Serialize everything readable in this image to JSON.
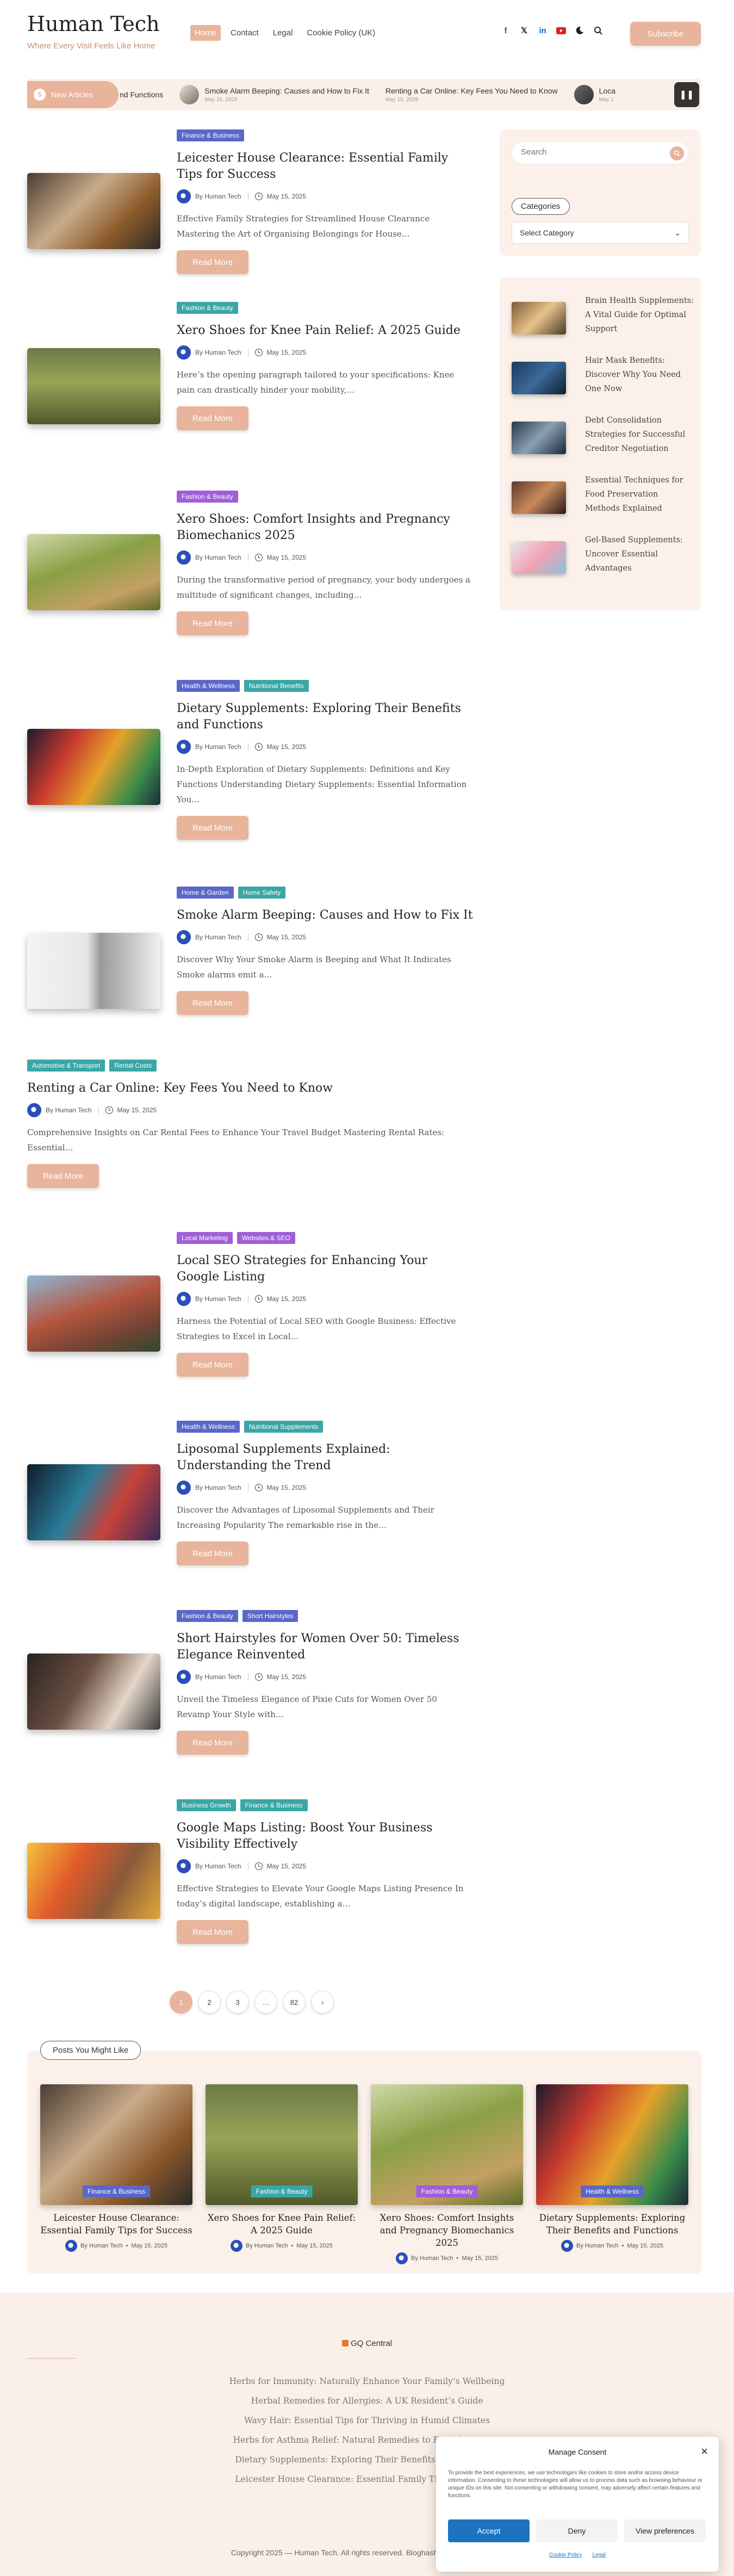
{
  "header": {
    "site_title": "Human Tech",
    "tagline": "Where Every Visit Feels Like Home",
    "nav": [
      "Home",
      "Contact",
      "Legal",
      "Cookie Policy (UK)"
    ],
    "subscribe_label": "Subscribe"
  },
  "ticker": {
    "label": "New Articles",
    "count": "5",
    "items": [
      {
        "title": "nd Functions",
        "date": ""
      },
      {
        "title": "Smoke Alarm Beeping: Causes and How to Fix It",
        "date": "May 15, 2025"
      },
      {
        "title": "Renting a Car Online: Key Fees You Need to Know",
        "date": "May 15, 2025"
      },
      {
        "title": "Loca",
        "date": "May 1"
      }
    ],
    "pause_icon": "pause-icon"
  },
  "posts": [
    {
      "cats": [
        "Finance & Business"
      ],
      "title": "Leicester House Clearance: Essential Family Tips for Success",
      "author": "By Human Tech",
      "date": "May 15, 2025",
      "excerpt": "Effective Family Strategies for Streamlined House Clearance Mastering the Art of Organising Belongings for House…",
      "more": "Read More"
    },
    {
      "cats": [
        "Fashion & Beauty"
      ],
      "title": "Xero Shoes for Knee Pain Relief: A 2025 Guide",
      "author": "By Human Tech",
      "date": "May 15, 2025",
      "excerpt": "Here’s the opening paragraph tailored to your specifications: Knee pain can drastically hinder your mobility,…",
      "more": "Read More"
    },
    {
      "cats": [
        "Fashion & Beauty"
      ],
      "title": "Xero Shoes: Comfort Insights and Pregnancy Biomechanics 2025",
      "author": "By Human Tech",
      "date": "May 15, 2025",
      "excerpt": "During the transformative period of pregnancy, your body undergoes a multitude of significant changes, including…",
      "more": "Read More"
    },
    {
      "cats": [
        "Health & Wellness",
        "Nutritional Benefits"
      ],
      "title": "Dietary Supplements: Exploring Their Benefits and Functions",
      "author": "By Human Tech",
      "date": "May 15, 2025",
      "excerpt": "In-Depth Exploration of Dietary Supplements: Definitions and Key Functions Understanding Dietary Supplements: Essential Information You…",
      "more": "Read More"
    },
    {
      "cats": [
        "Home & Garden",
        "Home Safety"
      ],
      "title": "Smoke Alarm Beeping: Causes and How to Fix It",
      "author": "By Human Tech",
      "date": "May 15, 2025",
      "excerpt": "Discover Why Your Smoke Alarm is Beeping and What It Indicates Smoke alarms emit a…",
      "more": "Read More"
    },
    {
      "cats": [
        "Automotive & Transport",
        "Rental Costs"
      ],
      "title": "Renting a Car Online: Key Fees You Need to Know",
      "author": "By Human Tech",
      "date": "May 15, 2025",
      "excerpt": "Comprehensive Insights on Car Rental Fees to Enhance Your Travel Budget Mastering Rental Rates: Essential…",
      "more": "Read More"
    },
    {
      "cats": [
        "Local Marketing",
        "Websites & SEO"
      ],
      "title": "Local SEO Strategies for Enhancing Your Google Listing",
      "author": "By Human Tech",
      "date": "May 15, 2025",
      "excerpt": "Harness the Potential of Local SEO with Google Business: Effective Strategies to Excel in Local…",
      "more": "Read More"
    },
    {
      "cats": [
        "Health & Wellness",
        "Nutritional Supplements"
      ],
      "title": "Liposomal Supplements Explained: Understanding the Trend",
      "author": "By Human Tech",
      "date": "May 15, 2025",
      "excerpt": "Discover the Advantages of Liposomal Supplements and Their Increasing Popularity The remarkable rise in the…",
      "more": "Read More"
    },
    {
      "cats": [
        "Fashion & Beauty",
        "Short Hairstyles"
      ],
      "title": "Short Hairstyles for Women Over 50: Timeless Elegance Reinvented",
      "author": "By Human Tech",
      "date": "May 15, 2025",
      "excerpt": "Unveil the Timeless Elegance of Pixie Cuts for Women Over 50 Revamp Your Style with…",
      "more": "Read More"
    },
    {
      "cats": [
        "Business Growth",
        "Finance & Business"
      ],
      "title": "Google Maps Listing: Boost Your Business Visibility Effectively",
      "author": "By Human Tech",
      "date": "May 15, 2025",
      "excerpt": "Effective Strategies to Elevate Your Google Maps Listing Presence In today’s digital landscape, establishing a…",
      "more": "Read More"
    }
  ],
  "sidebar": {
    "search_placeholder": "Search",
    "categories_heading": "Categories",
    "select_label": "Select Category",
    "recent": [
      "Brain Health Supplements: A Vital Guide for Optimal Support",
      "Hair Mask Benefits: Discover Why You Need One Now",
      "Debt Consolidation Strategies for Successful Creditor Negotiation",
      "Essential Techniques for Food Preservation Methods Explained",
      "Gel-Based Supplements: Uncover Essential Advantages"
    ]
  },
  "pagination": [
    "1",
    "2",
    "3",
    "…",
    "82",
    "›"
  ],
  "related": {
    "heading": "Posts You Might Like",
    "items": [
      {
        "cat": "Finance & Business",
        "title": "Leicester House Clearance: Essential Family Tips for Success",
        "author": "By Human Tech",
        "date": "May 15, 2025"
      },
      {
        "cat": "Fashion & Beauty",
        "title": "Xero Shoes for Knee Pain Relief: A 2025 Guide",
        "author": "By Human Tech",
        "date": "May 15, 2025"
      },
      {
        "cat": "Fashion & Beauty",
        "title": "Xero Shoes: Comfort Insights and Pregnancy Biomechanics 2025",
        "author": "By Human Tech",
        "date": "May 15, 2025"
      },
      {
        "cat": "Health & Wellness",
        "title": "Dietary Supplements: Exploring Their Benefits and Functions",
        "author": "By Human Tech",
        "date": "May 15, 2025"
      }
    ]
  },
  "footer": {
    "brand": "GQ Central",
    "links": [
      "Herbs for Immunity: Naturally Enhance Your Family’s Wellbeing",
      "Herbal Remedies for Allergies: A UK Resident’s Guide",
      "Wavy Hair: Essential Tips for Thriving in Humid Climates",
      "Herbs for Asthma Relief: Natural Remedies to Ease Symptoms",
      "Dietary Supplements: Exploring Their Benefits and Functions",
      "Leicester House Clearance: Essential Family Tips for Success"
    ],
    "copyright": "Copyright 2025 — Human Tech. All rights reserved. Bloghash WordPress Theme"
  },
  "consent": {
    "title": "Manage Consent",
    "text": "To provide the best experiences, we use technologies like cookies to store and/or access device information. Consenting to these technologies will allow us to process data such as browsing behaviour or unique IDs on this site. Not consenting or withdrawing consent, may adversely affect certain features and functions.",
    "accept": "Accept",
    "deny": "Deny",
    "preferences": "View preferences",
    "links": [
      "Cookie Policy",
      "Legal"
    ]
  },
  "colors": {
    "accent": "#e8b49b",
    "tag_blue": "#5a67c9",
    "tag_teal": "#3aa6a6",
    "tag_purple": "#a05ed8",
    "consent_blue": "#1e73be"
  }
}
